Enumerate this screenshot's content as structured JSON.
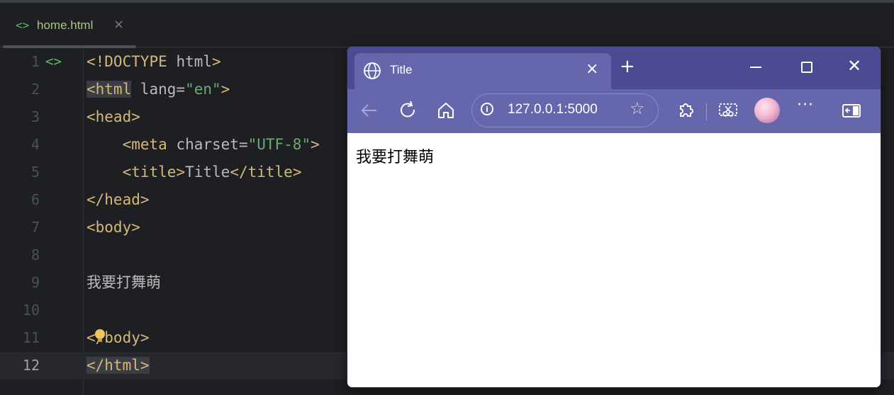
{
  "editor": {
    "tab": {
      "icon": "<>",
      "name": "home.html",
      "close": "×"
    },
    "lines": [
      {
        "n": "1",
        "parts": [
          [
            "tg",
            "<!DOCTYPE "
          ],
          [
            "at",
            "html"
          ],
          [
            "tg",
            ">"
          ]
        ]
      },
      {
        "n": "2",
        "parts": [
          [
            "tg hl",
            "<html"
          ],
          [
            "at",
            " lang="
          ],
          [
            "st",
            "\"en\""
          ],
          [
            "tg",
            ">"
          ]
        ]
      },
      {
        "n": "3",
        "parts": [
          [
            "tg",
            "<head>"
          ]
        ]
      },
      {
        "n": "4",
        "parts": [
          [
            "at",
            "    "
          ],
          [
            "tg",
            "<meta"
          ],
          [
            "at",
            " charset="
          ],
          [
            "st",
            "\"UTF-8\""
          ],
          [
            "tg",
            ">"
          ]
        ]
      },
      {
        "n": "5",
        "parts": [
          [
            "at",
            "    "
          ],
          [
            "tg",
            "<title>"
          ],
          [
            "at",
            "Title"
          ],
          [
            "tg",
            "</title>"
          ]
        ]
      },
      {
        "n": "6",
        "parts": [
          [
            "tg",
            "</head>"
          ]
        ]
      },
      {
        "n": "7",
        "parts": [
          [
            "tg",
            "<body>"
          ]
        ]
      },
      {
        "n": "8",
        "parts": []
      },
      {
        "n": "9",
        "parts": [
          [
            "at",
            "我要打舞萌"
          ]
        ]
      },
      {
        "n": "10",
        "parts": []
      },
      {
        "n": "11",
        "parts": [
          [
            "tg",
            "</body>"
          ]
        ]
      },
      {
        "n": "12",
        "parts": [
          [
            "tg hl",
            "</html>"
          ]
        ]
      }
    ],
    "gutter_icon": "<>",
    "current_line": 12
  },
  "browser": {
    "tab_title": "Title",
    "tab_close": "×",
    "new_tab": "+",
    "url": "127.0.0.1:5000",
    "more": "···",
    "page_text": "我要打舞萌",
    "colors": {
      "titlebar": "#4b4a93",
      "toolbar": "#6566ac"
    }
  }
}
